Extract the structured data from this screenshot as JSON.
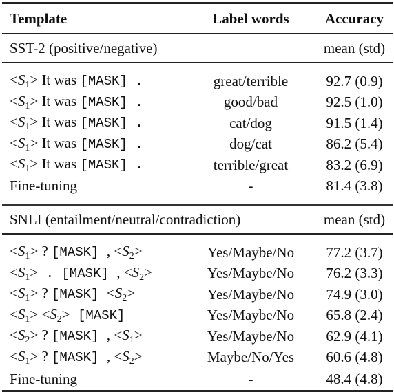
{
  "table": {
    "headers": [
      "Template",
      "Label words",
      "Accuracy"
    ],
    "sections": [
      {
        "title": "SST-2 (positive/negative)",
        "metric": "mean (std)",
        "rows": [
          {
            "template": [
              {
                "t": "lt"
              },
              {
                "t": "var",
                "v": "S",
                "s": "1"
              },
              {
                "t": "gt"
              },
              {
                "t": "txt",
                "v": " It was "
              },
              {
                "t": "mono",
                "v": "[MASK] ."
              }
            ],
            "label_words": "great/terrible",
            "accuracy": "92.7 (0.9)"
          },
          {
            "template": [
              {
                "t": "lt"
              },
              {
                "t": "var",
                "v": "S",
                "s": "1"
              },
              {
                "t": "gt"
              },
              {
                "t": "txt",
                "v": " It was "
              },
              {
                "t": "mono",
                "v": "[MASK] ."
              }
            ],
            "label_words": "good/bad",
            "accuracy": "92.5 (1.0)"
          },
          {
            "template": [
              {
                "t": "lt"
              },
              {
                "t": "var",
                "v": "S",
                "s": "1"
              },
              {
                "t": "gt"
              },
              {
                "t": "txt",
                "v": " It was "
              },
              {
                "t": "mono",
                "v": "[MASK] ."
              }
            ],
            "label_words": "cat/dog",
            "accuracy": "91.5 (1.4)"
          },
          {
            "template": [
              {
                "t": "lt"
              },
              {
                "t": "var",
                "v": "S",
                "s": "1"
              },
              {
                "t": "gt"
              },
              {
                "t": "txt",
                "v": " It was "
              },
              {
                "t": "mono",
                "v": "[MASK] ."
              }
            ],
            "label_words": "dog/cat",
            "accuracy": "86.2 (5.4)"
          },
          {
            "template": [
              {
                "t": "lt"
              },
              {
                "t": "var",
                "v": "S",
                "s": "1"
              },
              {
                "t": "gt"
              },
              {
                "t": "txt",
                "v": " It was "
              },
              {
                "t": "mono",
                "v": "[MASK] ."
              }
            ],
            "label_words": "terrible/great",
            "accuracy": "83.2 (6.9)"
          },
          {
            "template": [
              {
                "t": "txt",
                "v": "Fine-tuning"
              }
            ],
            "label_words": "-",
            "accuracy": "81.4 (3.8)"
          }
        ]
      },
      {
        "title": "SNLI (entailment/neutral/contradiction)",
        "metric": "mean (std)",
        "rows": [
          {
            "template": [
              {
                "t": "lt"
              },
              {
                "t": "var",
                "v": "S",
                "s": "1"
              },
              {
                "t": "gt"
              },
              {
                "t": "txt",
                "v": " ? "
              },
              {
                "t": "mono",
                "v": "[MASK] "
              },
              {
                "t": "txt",
                "v": ", "
              },
              {
                "t": "lt"
              },
              {
                "t": "var",
                "v": "S",
                "s": "2"
              },
              {
                "t": "gt"
              }
            ],
            "label_words": "Yes/Maybe/No",
            "accuracy": "77.2 (3.7)"
          },
          {
            "template": [
              {
                "t": "lt"
              },
              {
                "t": "var",
                "v": "S",
                "s": "1"
              },
              {
                "t": "gt"
              },
              {
                "t": "mono",
                "v": " . [MASK] "
              },
              {
                "t": "txt",
                "v": ", "
              },
              {
                "t": "lt"
              },
              {
                "t": "var",
                "v": "S",
                "s": "2"
              },
              {
                "t": "gt"
              }
            ],
            "label_words": "Yes/Maybe/No",
            "accuracy": "76.2 (3.3)"
          },
          {
            "template": [
              {
                "t": "lt"
              },
              {
                "t": "var",
                "v": "S",
                "s": "1"
              },
              {
                "t": "gt"
              },
              {
                "t": "txt",
                "v": " ? "
              },
              {
                "t": "mono",
                "v": "[MASK] "
              },
              {
                "t": "lt"
              },
              {
                "t": "var",
                "v": "S",
                "s": "2"
              },
              {
                "t": "gt"
              }
            ],
            "label_words": "Yes/Maybe/No",
            "accuracy": "74.9 (3.0)"
          },
          {
            "template": [
              {
                "t": "lt"
              },
              {
                "t": "var",
                "v": "S",
                "s": "1"
              },
              {
                "t": "gt"
              },
              {
                "t": "txt",
                "v": " "
              },
              {
                "t": "lt"
              },
              {
                "t": "var",
                "v": "S",
                "s": "2"
              },
              {
                "t": "gt"
              },
              {
                "t": "mono",
                "v": " [MASK]"
              }
            ],
            "label_words": "Yes/Maybe/No",
            "accuracy": "65.8 (2.4)"
          },
          {
            "template": [
              {
                "t": "lt"
              },
              {
                "t": "var",
                "v": "S",
                "s": "2"
              },
              {
                "t": "gt"
              },
              {
                "t": "txt",
                "v": " ? "
              },
              {
                "t": "mono",
                "v": "[MASK] "
              },
              {
                "t": "txt",
                "v": ", "
              },
              {
                "t": "lt"
              },
              {
                "t": "var",
                "v": "S",
                "s": "1"
              },
              {
                "t": "gt"
              }
            ],
            "label_words": "Yes/Maybe/No",
            "accuracy": "62.9 (4.1)"
          },
          {
            "template": [
              {
                "t": "lt"
              },
              {
                "t": "var",
                "v": "S",
                "s": "1"
              },
              {
                "t": "gt"
              },
              {
                "t": "txt",
                "v": " ? "
              },
              {
                "t": "mono",
                "v": "[MASK] "
              },
              {
                "t": "txt",
                "v": ", "
              },
              {
                "t": "lt"
              },
              {
                "t": "var",
                "v": "S",
                "s": "2"
              },
              {
                "t": "gt"
              }
            ],
            "label_words": "Maybe/No/Yes",
            "accuracy": "60.6 (4.8)"
          },
          {
            "template": [
              {
                "t": "txt",
                "v": "Fine-tuning"
              }
            ],
            "label_words": "-",
            "accuracy": "48.4 (4.8)"
          }
        ]
      }
    ]
  }
}
